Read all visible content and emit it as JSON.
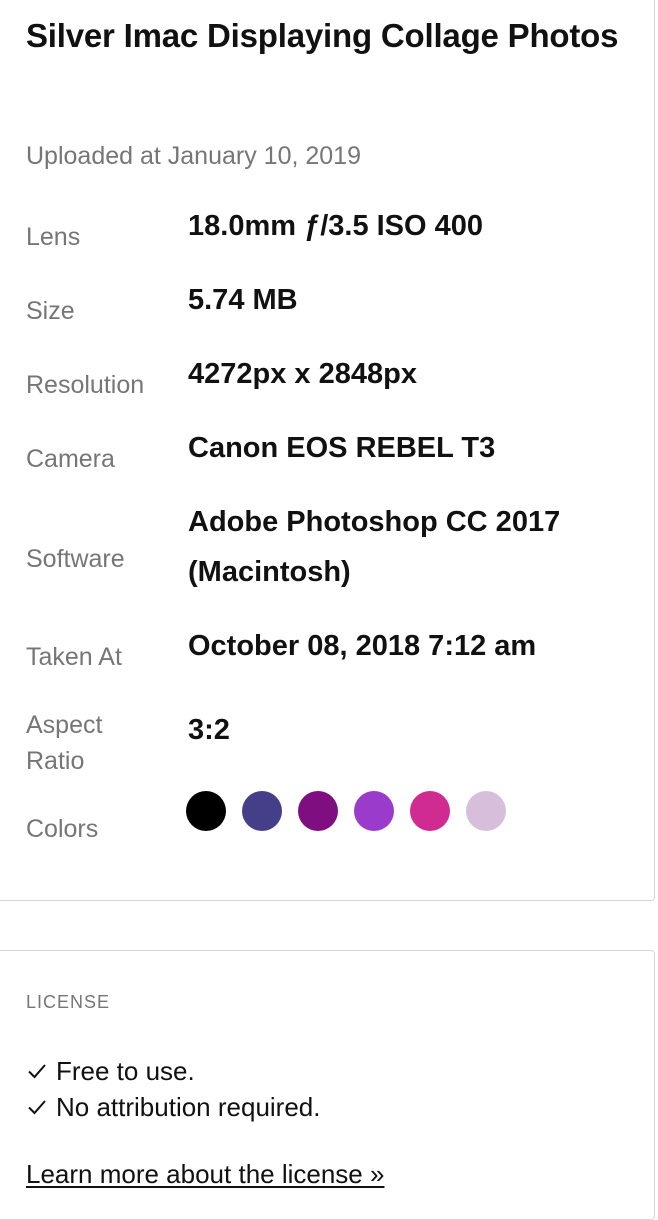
{
  "photo": {
    "title": "Silver Imac Displaying Collage Photos",
    "uploaded": "Uploaded at January 10, 2019"
  },
  "details": [
    {
      "label": "Lens",
      "value": "18.0mm ƒ/3.5 ISO 400"
    },
    {
      "label": "Size",
      "value": "5.74 MB"
    },
    {
      "label": "Resolution",
      "value": "4272px x 2848px"
    },
    {
      "label": "Camera",
      "value": "Canon EOS REBEL T3"
    },
    {
      "label": "Software",
      "value": "Adobe Photoshop CC 2017 (Macintosh)"
    },
    {
      "label": "Taken At",
      "value": "October 08, 2018 7:12 am"
    },
    {
      "label": "Aspect Ratio",
      "value": "3:2"
    }
  ],
  "colors": {
    "label": "Colors",
    "swatches": [
      "#000000",
      "#453F8A",
      "#7F0E80",
      "#9B3BCB",
      "#D02B91",
      "#D7BFDC"
    ]
  },
  "license": {
    "heading": "LICENSE",
    "items": [
      "Free to use.",
      "No attribution required."
    ],
    "link": "Learn more about the license »"
  }
}
